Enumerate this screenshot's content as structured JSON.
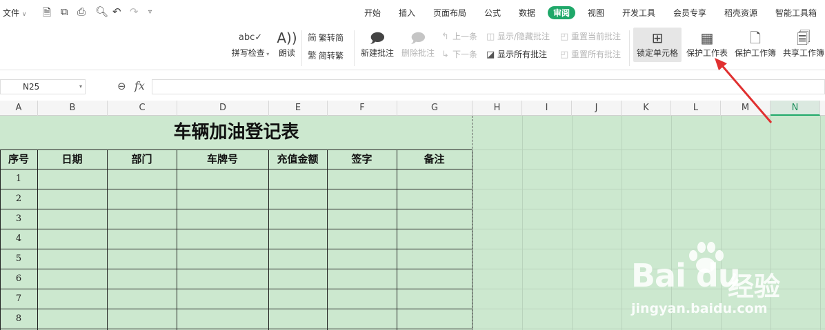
{
  "topbar": {
    "file_menu": "文件",
    "quick_access": [
      "save-icon",
      "export-icon",
      "print-icon",
      "preview-icon",
      "undo-icon",
      "redo-icon",
      "more-icon"
    ],
    "tabs": [
      "开始",
      "插入",
      "页面布局",
      "公式",
      "数据",
      "审阅",
      "视图",
      "开发工具",
      "会员专享",
      "稻壳资源",
      "智能工具箱"
    ],
    "active_tab": "审阅"
  },
  "ribbon": {
    "spell_check": "拼写检查",
    "read_aloud": "朗读",
    "trad_to_simp": "繁转简",
    "simp_to_trad": "简转繁",
    "new_comment": "新建批注",
    "delete_comment": "删除批注",
    "prev": "上一条",
    "next": "下一条",
    "show_hide_comment": "显示/隐藏批注",
    "show_all_comments": "显示所有批注",
    "reset_current_comment": "重置当前批注",
    "reset_all_comments": "重置所有批注",
    "lock_cell": "锁定单元格",
    "protect_sheet": "保护工作表",
    "protect_workbook": "保护工作簿",
    "share_workbook": "共享工作簿"
  },
  "formula_bar": {
    "name_box": "N25",
    "fx_label": "fx",
    "value": ""
  },
  "columns": [
    "A",
    "B",
    "C",
    "D",
    "E",
    "F",
    "G",
    "H",
    "I",
    "J",
    "K",
    "L",
    "M",
    "N"
  ],
  "selected_column": "N",
  "sheet": {
    "title": "车辆加油登记表",
    "headers": [
      "序号",
      "日期",
      "部门",
      "车牌号",
      "充值金额",
      "签字",
      "备注"
    ],
    "row_numbers": [
      "1",
      "2",
      "3",
      "4",
      "5",
      "6",
      "7",
      "8"
    ]
  },
  "watermark": {
    "logo": "Bai du",
    "cn": "经验",
    "url": "jingyan.baidu.com"
  },
  "colors": {
    "accent": "#1fa869",
    "sheet_bg": "#cce8cf",
    "arrow": "#e03030"
  }
}
